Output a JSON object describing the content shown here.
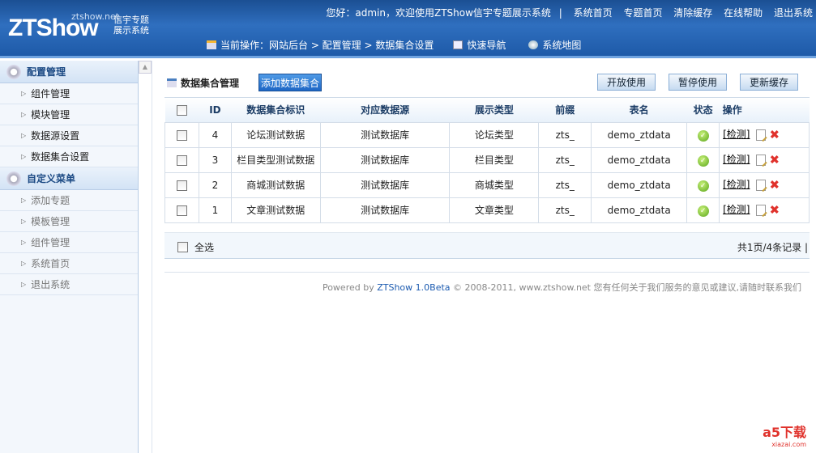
{
  "header": {
    "logo_text": "ZTShow",
    "logo_net": "ztshow.net",
    "logo_cn1": "信宇专题",
    "logo_cn2": "展示系统",
    "greeting": "您好：admin，欢迎使用ZTShow信宇专题展示系统",
    "sep": "|",
    "links": [
      "系统首页",
      "专题首页",
      "清除缓存",
      "在线帮助",
      "退出系统"
    ],
    "breadcrumb": "当前操作：网站后台 > 配置管理 > 数据集合设置",
    "quick_nav": "快速导航",
    "sitemap": "系统地图"
  },
  "sidebar": {
    "sections": [
      {
        "title": "配置管理",
        "items": [
          "组件管理",
          "模块管理",
          "数据源设置",
          "数据集合设置"
        ]
      },
      {
        "title": "自定义菜单",
        "items": [
          "添加专题",
          "模板管理",
          "组件管理",
          "系统首页",
          "退出系统"
        ]
      }
    ]
  },
  "main": {
    "title": "数据集合管理",
    "add_button": "添加数据集合",
    "buttons": [
      "开放使用",
      "暂停使用",
      "更新缓存"
    ],
    "columns": [
      "ID",
      "数据集合标识",
      "对应数据源",
      "展示类型",
      "前缀",
      "表名",
      "状态",
      "操作"
    ],
    "rows": [
      {
        "id": "4",
        "name": "论坛测试数据",
        "source": "测试数据库",
        "type": "论坛类型",
        "prefix": "zts_",
        "table": "demo_ztdata",
        "check": "[检测]"
      },
      {
        "id": "3",
        "name": "栏目类型测试数据",
        "source": "测试数据库",
        "type": "栏目类型",
        "prefix": "zts_",
        "table": "demo_ztdata",
        "check": "[检测]"
      },
      {
        "id": "2",
        "name": "商城测试数据",
        "source": "测试数据库",
        "type": "商城类型",
        "prefix": "zts_",
        "table": "demo_ztdata",
        "check": "[检测]"
      },
      {
        "id": "1",
        "name": "文章测试数据",
        "source": "测试数据库",
        "type": "文章类型",
        "prefix": "zts_",
        "table": "demo_ztdata",
        "check": "[检测]"
      }
    ],
    "select_all": "全选",
    "pagination": "共1页/4条记录 |"
  },
  "footer": {
    "powered_by": "Powered by",
    "product": "ZTShow 1.0Beta",
    "rest": "© 2008-2011, www.ztshow.net 您有任何关于我们服务的意见或建议,请随时联系我们"
  },
  "watermark": {
    "text": "a5下载",
    "sub": "xiazai.com"
  }
}
